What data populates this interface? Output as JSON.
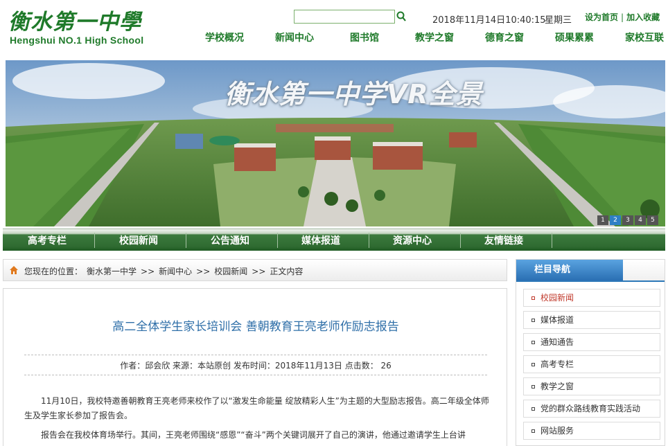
{
  "header": {
    "logo_cn": "衡水第一中學",
    "logo_en": "Hengshui NO.1 High  School",
    "datetime": "2018年11月14日10:40:15",
    "weekday": "星期三",
    "set_home": "设为首页",
    "separator": "|",
    "add_favorite": "加入收藏",
    "nav": [
      "学校概况",
      "新闻中心",
      "图书馆",
      "教学之窗",
      "德育之窗",
      "硕果累累",
      "家校互联"
    ]
  },
  "banner": {
    "title": "衡水第一中学VR全景",
    "pages": [
      "1",
      "2",
      "3",
      "4",
      "5"
    ],
    "active_page": 1
  },
  "greenbar": [
    "高考专栏",
    "校园新闻",
    "公告通知",
    "媒体报道",
    "资源中心",
    "友情链接"
  ],
  "breadcrumb": {
    "prefix": "您现在的位置：",
    "items": [
      "衡水第一中学",
      ">>",
      "新闻中心",
      ">>",
      "校园新闻",
      ">>",
      "正文内容"
    ]
  },
  "article": {
    "title": "高二全体学生家长培训会 善朝教育王亮老师作励志报告",
    "meta": "作者：邱会欣 来源：本站原创 发布时间：2018年11月13日 点击数：  26",
    "p1": "11月10日，我校特邀善朝教育王亮老师来校作了以“激发生命能量 绽放精彩人生”为主题的大型励志报告。高二年级全体师生及学生家长参加了报告会。",
    "p2": "报告会在我校体育场举行。其间，王亮老师围绕“感恩”“奋斗”两个关键词展开了自己的演讲，他通过邀请学生上台讲"
  },
  "sidebar": {
    "title": "栏目导航",
    "items": [
      "校园新闻",
      "媒体报道",
      "通知通告",
      "高考专栏",
      "教学之窗",
      "党的群众路线教育实践活动",
      "网站服务"
    ],
    "active_index": 0
  },
  "colors": {
    "brand_green": "#1f7a2a",
    "title_blue": "#2f6fa8",
    "tab_blue": "#2a6fb3",
    "active_red": "#c0392b"
  }
}
